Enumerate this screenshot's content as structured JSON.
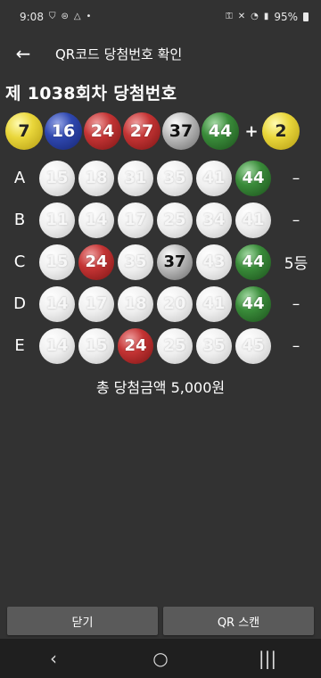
{
  "status": {
    "time": "9:08",
    "left_icons": [
      "notification-icon",
      "lock-icon",
      "warning-icon"
    ],
    "battery": "95%"
  },
  "app": {
    "title": "QR코드 당첨번호 확인",
    "back_icon": "back-arrow-icon"
  },
  "draw": {
    "title": "제 1038회차 당첨번호",
    "numbers": [
      {
        "n": "7",
        "color": "yellow"
      },
      {
        "n": "16",
        "color": "blue"
      },
      {
        "n": "24",
        "color": "red"
      },
      {
        "n": "27",
        "color": "red"
      },
      {
        "n": "37",
        "color": "gray"
      },
      {
        "n": "44",
        "color": "green"
      }
    ],
    "plus": "+",
    "bonus": {
      "n": "2",
      "color": "yellow"
    }
  },
  "games": [
    {
      "label": "A",
      "numbers": [
        "15",
        "18",
        "31",
        "35",
        "41",
        "44"
      ],
      "colors": [
        "white",
        "white",
        "white",
        "white",
        "white",
        "green"
      ],
      "result": "–"
    },
    {
      "label": "B",
      "numbers": [
        "11",
        "14",
        "17",
        "25",
        "34",
        "41"
      ],
      "colors": [
        "white",
        "white",
        "white",
        "white",
        "white",
        "white"
      ],
      "result": "–"
    },
    {
      "label": "C",
      "numbers": [
        "15",
        "24",
        "35",
        "37",
        "43",
        "44"
      ],
      "colors": [
        "white",
        "red",
        "white",
        "gray",
        "white",
        "green"
      ],
      "result": "5등"
    },
    {
      "label": "D",
      "numbers": [
        "14",
        "17",
        "18",
        "20",
        "41",
        "44"
      ],
      "colors": [
        "white",
        "white",
        "white",
        "white",
        "white",
        "green"
      ],
      "result": "–"
    },
    {
      "label": "E",
      "numbers": [
        "14",
        "15",
        "24",
        "25",
        "35",
        "45"
      ],
      "colors": [
        "white",
        "white",
        "red",
        "white",
        "white",
        "white"
      ],
      "result": "–"
    }
  ],
  "total": "총 당첨금액 5,000원",
  "buttons": {
    "close": "닫기",
    "scan": "QR 스캔"
  },
  "nav": {
    "back": "‹",
    "home": "○",
    "recents": "|||"
  }
}
